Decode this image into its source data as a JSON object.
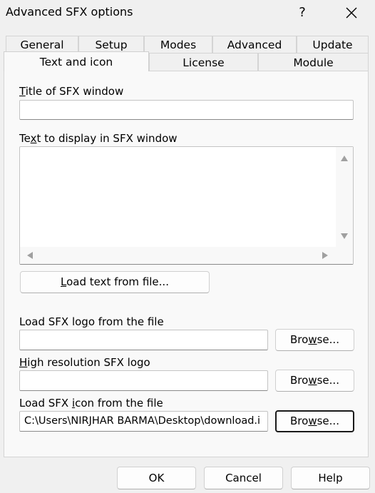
{
  "window": {
    "title": "Advanced SFX options",
    "help_glyph": "?",
    "close_icon": "close-icon"
  },
  "tabs_row1": [
    {
      "label": "General"
    },
    {
      "label": "Setup"
    },
    {
      "label": "Modes"
    },
    {
      "label": "Advanced"
    },
    {
      "label": "Update"
    }
  ],
  "tabs_row2": [
    {
      "label": "Text and icon",
      "active": true
    },
    {
      "label": "License"
    },
    {
      "label": "Module"
    }
  ],
  "panel": {
    "title_label": {
      "u": "T",
      "rest": "itle of SFX window"
    },
    "title_value": "",
    "text_label": {
      "pre": "Te",
      "u": "x",
      "rest": "t to display in SFX window"
    },
    "text_value": "",
    "load_text_button": {
      "u": "L",
      "rest": "oad text from file..."
    },
    "logo_label": {
      "pre": "Load SFX lo",
      "u": "g",
      "rest": "o from the file"
    },
    "logo_value": "",
    "hires_label": {
      "u": "H",
      "rest": "igh resolution SFX logo"
    },
    "hires_value": "",
    "icon_label": {
      "pre": "Load SFX ",
      "u": "i",
      "rest": "con from the file"
    },
    "icon_value": "C:\\Users\\NIRJHAR BARMA\\Desktop\\download.i",
    "browse": {
      "pre": "Bro",
      "u": "w",
      "rest": "se..."
    }
  },
  "footer": {
    "ok": "OK",
    "cancel": "Cancel",
    "help": "Help"
  }
}
